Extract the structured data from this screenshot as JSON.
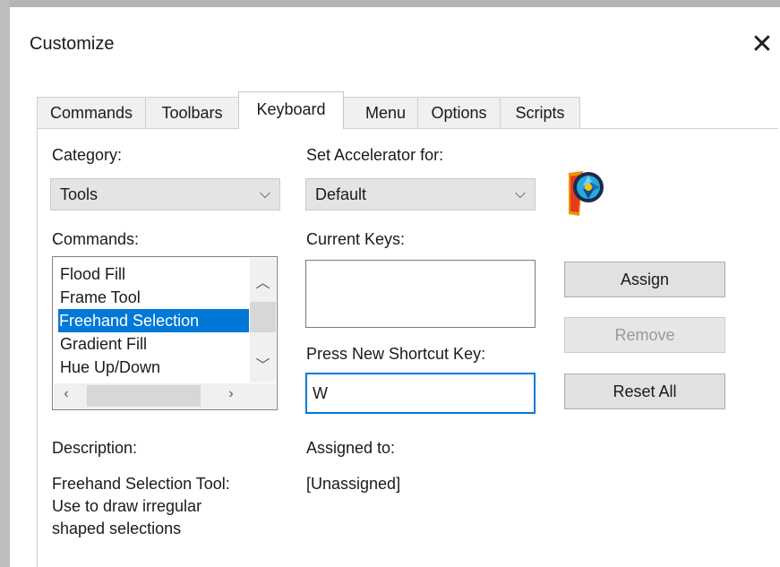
{
  "window": {
    "title": "Customize"
  },
  "tabs": [
    {
      "label": "Commands"
    },
    {
      "label": "Toolbars"
    },
    {
      "label": "Keyboard"
    },
    {
      "label": "Menu"
    },
    {
      "label": "Options"
    },
    {
      "label": "Scripts"
    }
  ],
  "active_tab": "Keyboard",
  "category": {
    "label": "Category:",
    "value": "Tools"
  },
  "accelerator": {
    "label": "Set Accelerator for:",
    "value": "Default"
  },
  "commands": {
    "label": "Commands:",
    "items": [
      "Flood Fill",
      "Frame Tool",
      "Freehand Selection",
      "Gradient Fill",
      "Hue Up/Down"
    ],
    "selected": "Freehand Selection"
  },
  "current_keys": {
    "label": "Current Keys:",
    "value": ""
  },
  "new_shortcut": {
    "label": "Press New Shortcut Key:",
    "value": "W"
  },
  "buttons": {
    "assign": "Assign",
    "remove": "Remove",
    "reset_all": "Reset All"
  },
  "description": {
    "label": "Description:",
    "lines": [
      "Freehand Selection Tool:",
      "Use to draw irregular",
      "shaped selections"
    ]
  },
  "assigned_to": {
    "label": "Assigned to:",
    "value": "[Unassigned]"
  },
  "icons": {
    "close": "close-icon",
    "chevron_down": "chevron-down-icon",
    "scroll_up": "chevron-up-icon",
    "scroll_down": "chevron-down-icon",
    "scroll_left": "chevron-left-icon",
    "scroll_right": "chevron-right-icon",
    "logo": "app-logo-icon"
  },
  "colors": {
    "selection": "#0078d7",
    "focus_border": "#0078d7",
    "disabled_text": "#9a9a9a"
  }
}
